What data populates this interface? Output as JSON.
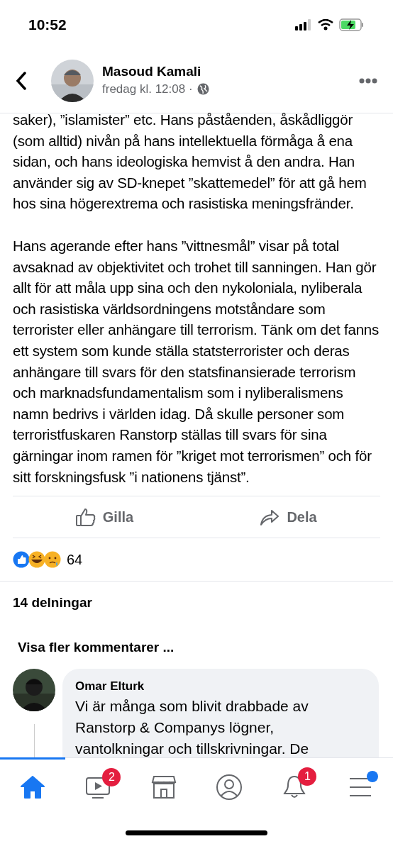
{
  "status_bar": {
    "time": "10:52"
  },
  "header": {
    "author": "Masoud Kamali",
    "meta": "fredag kl. 12:08 ·"
  },
  "post": {
    "paragraphs": [
      "saker), ”islamister” etc. Hans påståenden, åskådliggör (som alltid) nivån på hans intellektuella förmåga å ena sidan, och hans ideologiska hemvist å den andra. Han använder sig av SD-knepet ”skattemedel” för att gå hem hos sina högerextrema och rasistiska meningsfränder.",
      "Hans agerande efter hans ”vittnesmål” visar på total avsaknad av objektivitet och trohet till sanningen. Han gör allt för att måla upp sina och den nykoloniala, nyliberala och rasistiska världsordningens motståndare som terrorister eller anhängare till terrorism. Tänk om det fanns ett system som kunde ställa statsterrorister och deras anhängare till svars för den statsfinansierade terrorism och marknadsfundamentalism som i nyliberalismens namn bedrivs i världen idag. Då skulle personer som terroristfuskaren Ranstorp ställas till svars för sina gärningar inom ramen för ”kriget mot terrorismen” och för sitt forskningsfusk ”i nationens tjänst”."
    ]
  },
  "actions": [
    {
      "kind": "like",
      "label": "Gilla"
    },
    {
      "kind": "share",
      "label": "Dela"
    }
  ],
  "reactions": {
    "count": "64"
  },
  "shares": "14 delningar",
  "more_comments": "Visa fler kommentarer ...",
  "comment": {
    "author": "Omar Elturk",
    "text": "Vi är många som blivit drabbade av Ranstorp & Companys lögner, vantolkningar och tillskrivningar. De"
  },
  "tabs": [
    {
      "kind": "home",
      "selected": true
    },
    {
      "kind": "video",
      "selected": false,
      "badge": "2"
    },
    {
      "kind": "marketplace",
      "selected": false
    },
    {
      "kind": "profile",
      "selected": false
    },
    {
      "kind": "notifications",
      "selected": false,
      "badge": "1"
    },
    {
      "kind": "menu",
      "selected": false,
      "dot": true
    }
  ]
}
